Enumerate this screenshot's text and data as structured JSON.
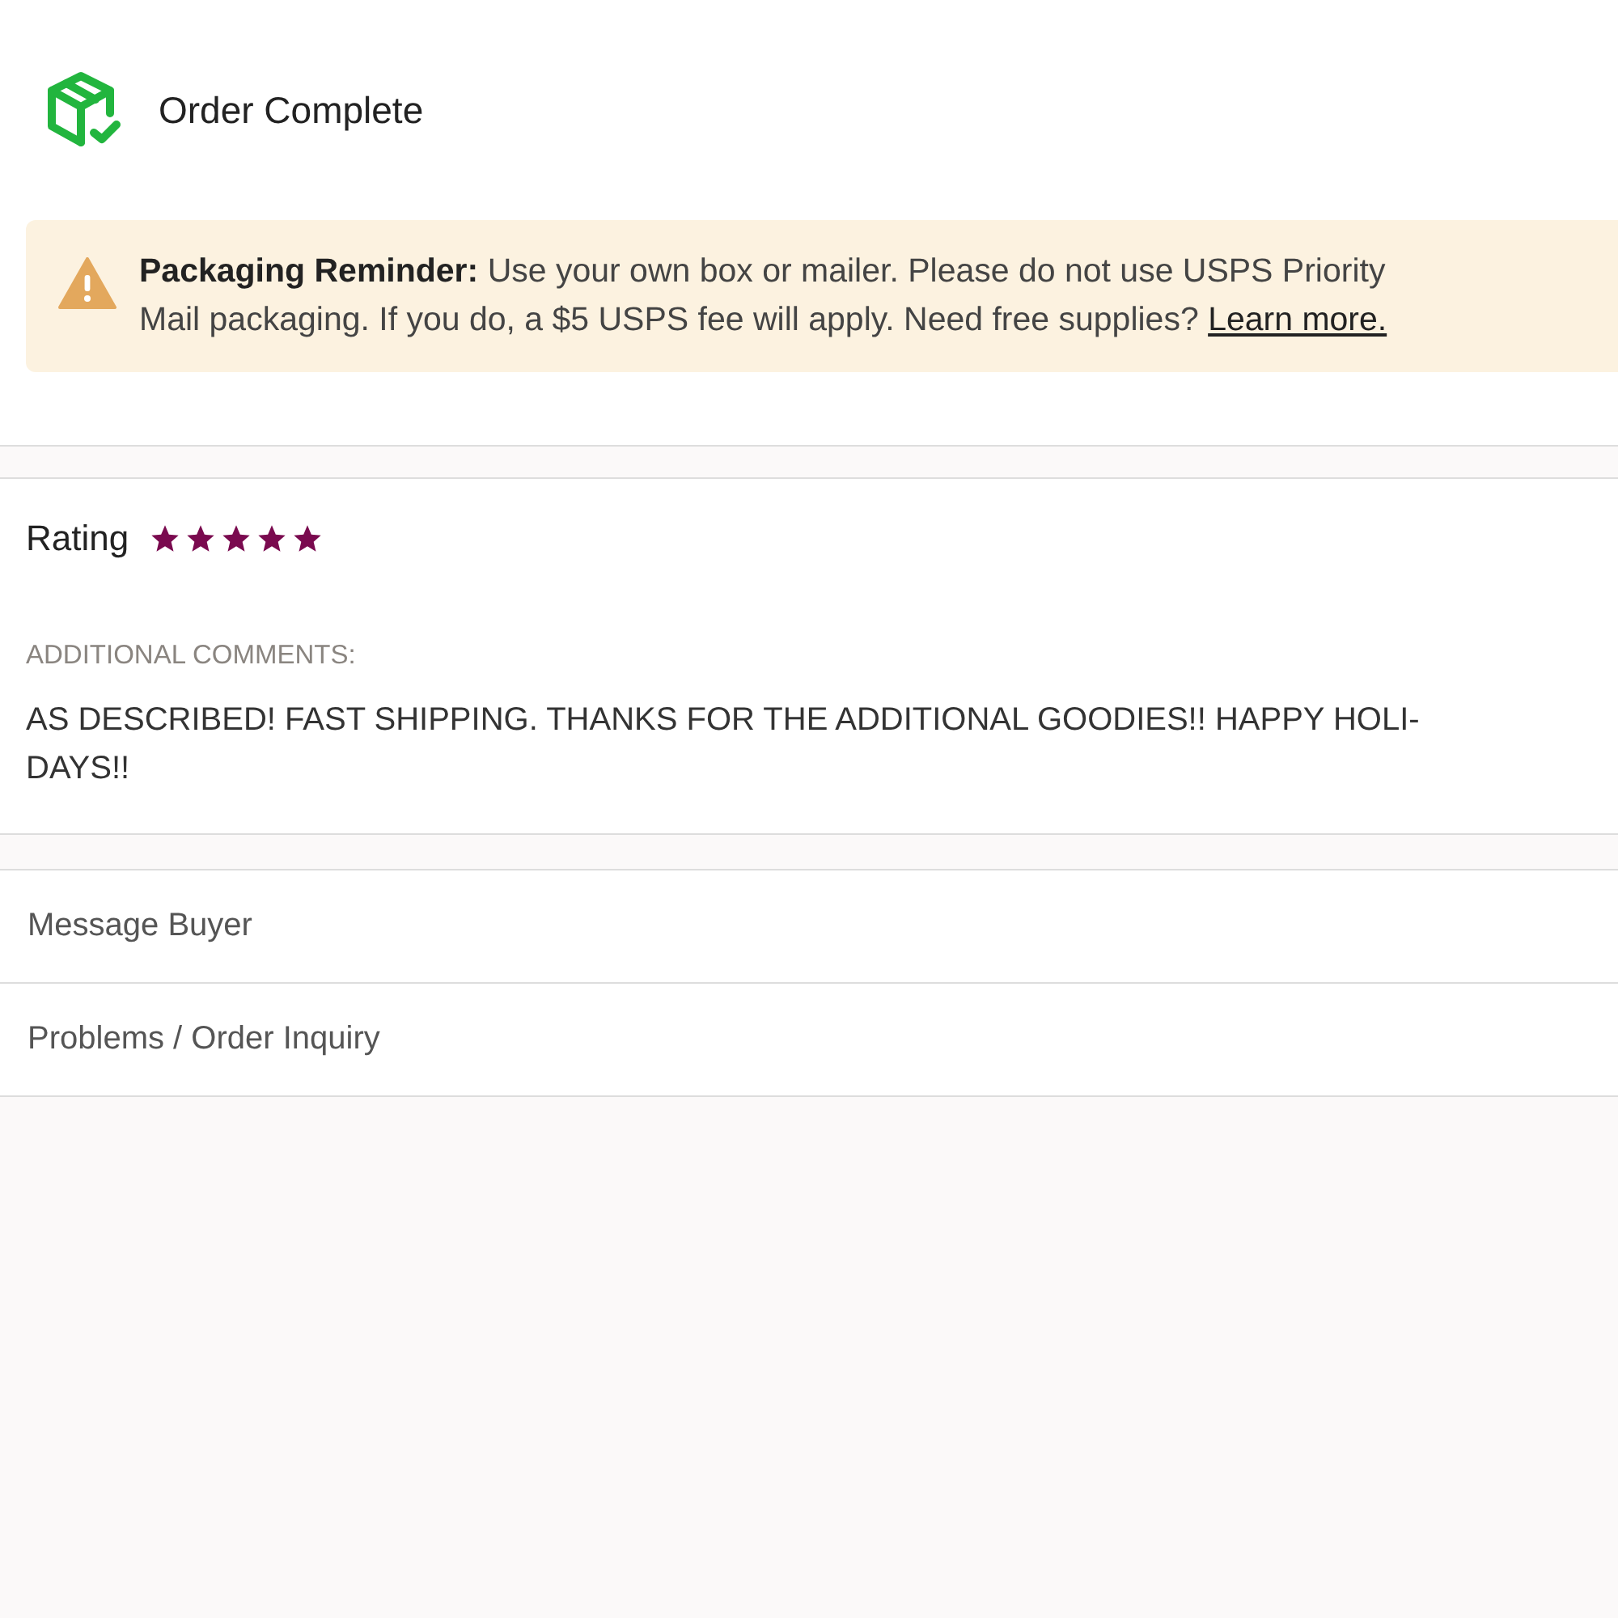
{
  "header": {
    "title": "Order Complete"
  },
  "reminder": {
    "text": "**Packaging Reminder:** Use your own box or mailer. Please do not use USPS Priority Mail packaging. If you do, a $5 USPS fee will apply. Need free supplies?",
    "link": "Learn more."
  },
  "review": {
    "label": "Rating",
    "stars": 5,
    "comments_label": "ADDITIONAL COMMENTS:",
    "comments": "AS DESCRIBED! FAST SHIPPING. THANKS FOR THE ADDITIONAL GOODIES!! HAPPY HOLI-DAYS!!"
  },
  "actions": [
    "Message Buyer",
    "Problems / Order Inquiry"
  ]
}
